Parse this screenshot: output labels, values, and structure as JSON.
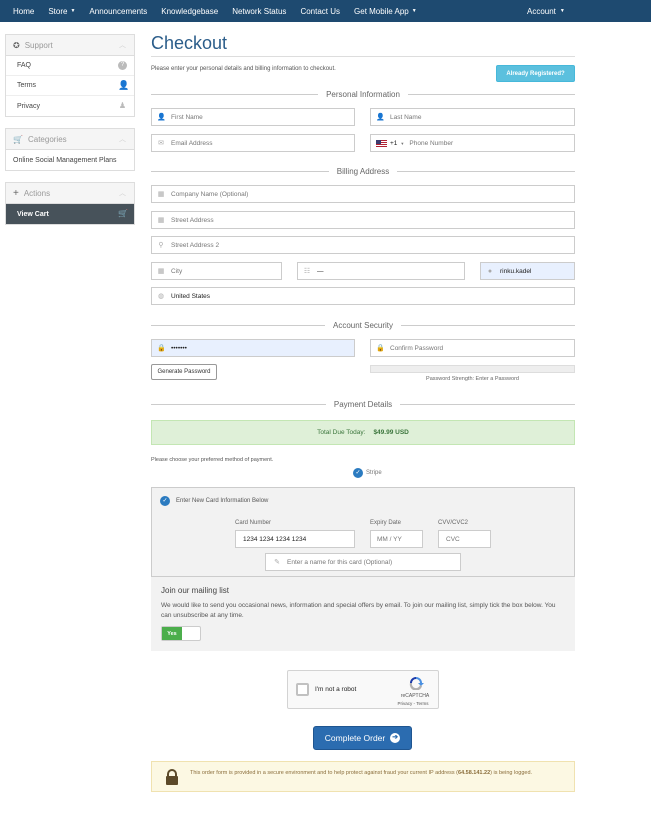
{
  "nav": {
    "items": [
      {
        "label": "Home",
        "caret": false
      },
      {
        "label": "Store",
        "caret": true
      },
      {
        "label": "Announcements",
        "caret": false
      },
      {
        "label": "Knowledgebase",
        "caret": false
      },
      {
        "label": "Network Status",
        "caret": false
      },
      {
        "label": "Contact Us",
        "caret": false
      },
      {
        "label": "Get Mobile App",
        "caret": true
      }
    ],
    "account": "Account",
    "bg_color": "#1e4a70"
  },
  "sidebar": {
    "support": {
      "title": "Support",
      "items": [
        "FAQ",
        "Terms",
        "Privacy"
      ]
    },
    "categories": {
      "title": "Categories",
      "items": [
        "Online Social Management Plans"
      ]
    },
    "actions": {
      "title": "Actions",
      "items": [
        "View Cart"
      ]
    }
  },
  "page": {
    "title": "Checkout",
    "intro": "Please enter your personal details and billing information to checkout.",
    "already_registered": "Already Registered?"
  },
  "sections": {
    "personal": "Personal Information",
    "billing": "Billing Address",
    "security": "Account Security",
    "payment": "Payment Details"
  },
  "fields": {
    "first_name": {
      "placeholder": "First Name",
      "icon": "user-icon"
    },
    "last_name": {
      "placeholder": "Last Name",
      "icon": "user-icon"
    },
    "email": {
      "placeholder": "Email Address",
      "icon": "envelope-icon"
    },
    "phone": {
      "placeholder": "Phone Number",
      "country_code": "+1"
    },
    "company": {
      "placeholder": "Company Name (Optional)",
      "icon": "building-icon"
    },
    "street": {
      "placeholder": "Street Address",
      "icon": "building-icon"
    },
    "street2": {
      "placeholder": "Street Address 2",
      "icon": "map-marker-icon"
    },
    "city": {
      "placeholder": "City",
      "icon": "building-icon"
    },
    "state": {
      "value": "—",
      "icon": "list-icon"
    },
    "postcode": {
      "value": "rinku.kadel",
      "icon": "certificate-icon"
    },
    "country": {
      "value": "United States",
      "icon": "globe-icon"
    },
    "password": {
      "value": "•••••••",
      "icon": "lock-icon"
    },
    "confirm_password": {
      "placeholder": "Confirm Password",
      "icon": "lock-icon"
    }
  },
  "security": {
    "generate": "Generate Password",
    "strength": "Password Strength: Enter a Password"
  },
  "payment": {
    "total_label": "Total Due Today:",
    "total_value": "$49.99 USD",
    "choose": "Please choose your preferred method of payment.",
    "method": "Stripe",
    "new_card": "Enter New Card Information Below",
    "card_number_label": "Card Number",
    "card_number_value": "1234 1234 1234 1234",
    "expiry_label": "Expiry Date",
    "expiry_value": "MM / YY",
    "cvv_label": "CVV/CVC2",
    "cvv_value": "CVC",
    "card_name_placeholder": "Enter a name for this card (Optional)"
  },
  "mailing": {
    "title": "Join our mailing list",
    "text": "We would like to send you occasional news, information and special offers by email. To join our mailing list, simply tick the box below. You can unsubscribe at any time.",
    "toggle": "Yes"
  },
  "captcha": {
    "label": "I'm not a robot",
    "brand": "reCAPTCHA",
    "links": "Privacy - Terms"
  },
  "order_button": "Complete Order",
  "notice": {
    "before": "This order form is provided in a secure environment and to help protect against fraud your current IP address (",
    "ip": "64.58.141.22",
    "after": ") is being logged."
  }
}
